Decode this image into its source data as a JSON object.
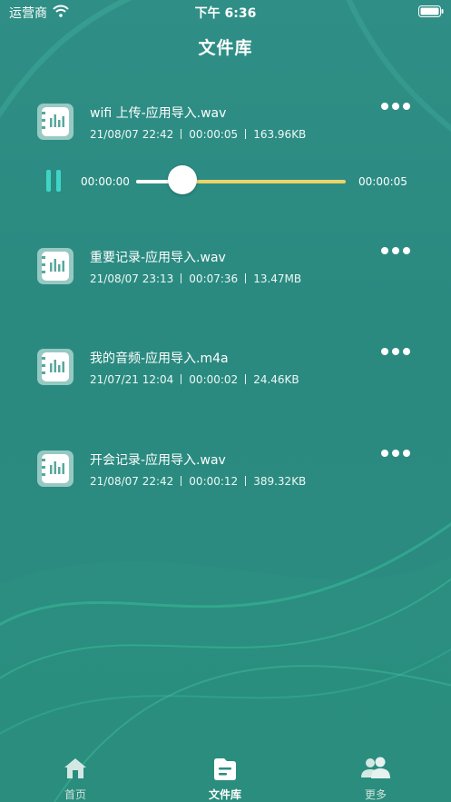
{
  "status_bar": {
    "carrier": "运营商",
    "time": "下午 6:36"
  },
  "page": {
    "title": "文件库"
  },
  "files": [
    {
      "name": "wifi 上传-应用导入.wav",
      "date": "21/08/07 22:42",
      "duration": "00:00:05",
      "size": "163.96KB"
    },
    {
      "name": "重要记录-应用导入.wav",
      "date": "21/08/07 23:13",
      "duration": "00:07:36",
      "size": "13.47MB"
    },
    {
      "name": "我的音频-应用导入.m4a",
      "date": "21/07/21 12:04",
      "duration": "00:00:02",
      "size": "24.46KB"
    },
    {
      "name": "开会记录-应用导入.wav",
      "date": "21/08/07 22:42",
      "duration": "00:00:12",
      "size": "389.32KB"
    }
  ],
  "player": {
    "current_time": "00:00:00",
    "total_time": "00:00:05",
    "progress": 0.22
  },
  "tab_bar": {
    "tabs": [
      {
        "label": "首页",
        "icon": "home-icon"
      },
      {
        "label": "文件库",
        "icon": "file-library-icon",
        "active": true
      },
      {
        "label": "更多",
        "icon": "users-icon"
      }
    ]
  },
  "colors": {
    "background": "#2b8b80",
    "accent_teal": "#3fd5c6",
    "progress_remaining": "#ead36a"
  }
}
